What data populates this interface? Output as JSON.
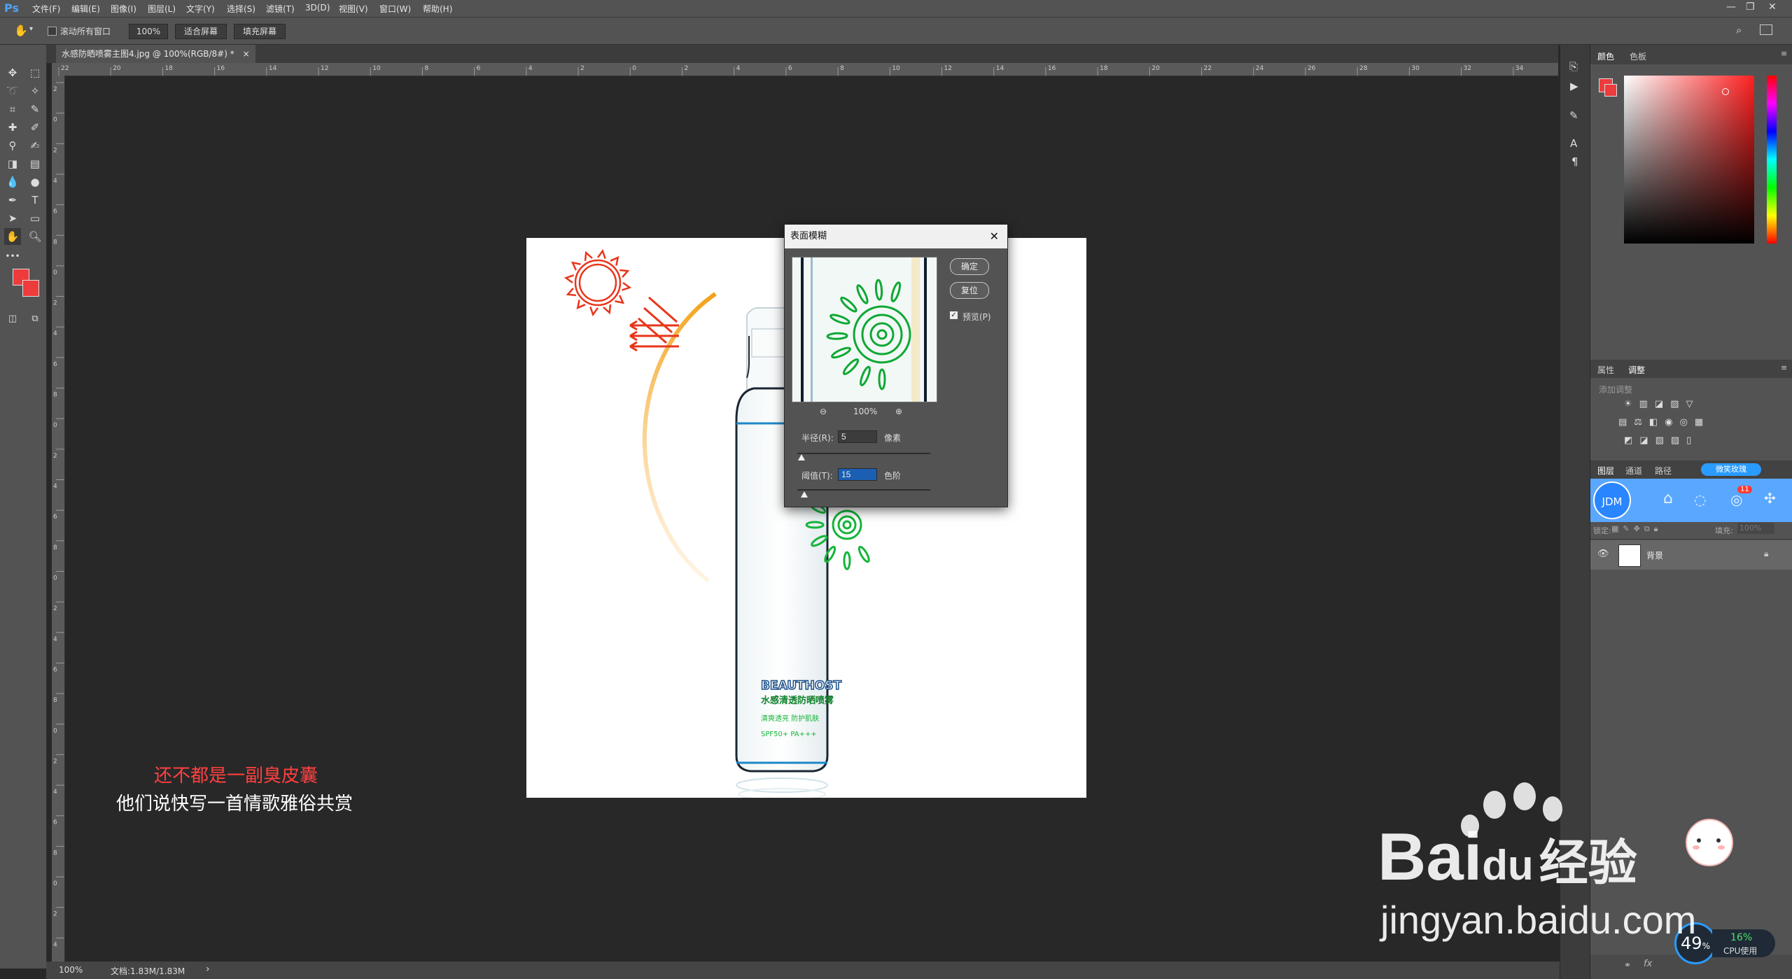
{
  "app": {
    "logo": "Ps",
    "menus": [
      "文件(F)",
      "编辑(E)",
      "图像(I)",
      "图层(L)",
      "文字(Y)",
      "选择(S)",
      "滤镜(T)",
      "3D(D)",
      "视图(V)",
      "窗口(W)",
      "帮助(H)"
    ],
    "window_controls": [
      "—",
      "❐",
      "✕"
    ]
  },
  "options": {
    "scroll_all_label": "滚动所有窗口",
    "zoom_value": "100%",
    "fit_screen": "适合屏幕",
    "fill_screen": "填充屏幕"
  },
  "document": {
    "tab_title": "水感防晒喷雾主图4.jpg @ 100%(RGB/8#) *",
    "close": "×"
  },
  "ruler": {
    "h_ticks": [
      "22",
      "20",
      "18",
      "16",
      "14",
      "12",
      "10",
      "8",
      "6",
      "4",
      "2",
      "0",
      "2",
      "4",
      "6",
      "8",
      "10",
      "12",
      "14",
      "16",
      "18",
      "20",
      "22",
      "24",
      "26",
      "28",
      "30",
      "32",
      "34"
    ],
    "v_ticks": [
      "2",
      "0",
      "2",
      "4",
      "6",
      "8",
      "0",
      "2",
      "4",
      "6",
      "8",
      "0",
      "2",
      "4",
      "6",
      "8",
      "0",
      "2",
      "4",
      "6",
      "8",
      "0",
      "2",
      "4",
      "6",
      "8",
      "0",
      "2",
      "4"
    ]
  },
  "canvas": {
    "product_brand": "BEAUTHOST",
    "product_line1": "水感清透防晒喷雾",
    "product_line2": "清爽透亮 防护肌肤",
    "product_line3": "SPF50+ PA+++"
  },
  "dialog": {
    "title": "表面模糊",
    "ok": "确定",
    "reset": "复位",
    "preview_label": "预览(P)",
    "preview_checked": true,
    "zoom_value": "100%",
    "radius_label": "半径(R):",
    "radius_value": "5",
    "radius_unit": "像素",
    "radius_slider": 0.03,
    "threshold_label": "阈值(T):",
    "threshold_value": "15",
    "threshold_unit": "色阶",
    "threshold_slider": 0.05
  },
  "subtitles": {
    "line1": "还不都是一副臭皮囊",
    "line2": "他们说快写一首情歌雅俗共赏"
  },
  "status": {
    "zoom": "100%",
    "doc_size": "文档:1.83M/1.83M",
    "arrow": "›"
  },
  "panels": {
    "color_tabs": [
      "颜色",
      "色板"
    ],
    "adjust_tabs": [
      "属性",
      "调整"
    ],
    "adjust_hint": "添加调整",
    "layer_tabs": [
      "图层",
      "通道",
      "路径"
    ],
    "lock_label": "锁定:",
    "fill_label": "填充:",
    "fill_value": "100%",
    "layer_name": "背景",
    "plugin_button": "微笑玫瑰",
    "jdm_label": "JDM",
    "jdm_badge": "11",
    "fx_label": "fx"
  },
  "cpu": {
    "percent": "49",
    "percent_suffix": "%",
    "usage": "16%",
    "usage_label": "CPU使用"
  },
  "watermark": {
    "brand": "Bai",
    "brand_du": "du",
    "product": "经验",
    "url": "jingyan.baidu.com"
  },
  "colors": {
    "foreground": "#ee3b3b",
    "background": "#ee3b3b",
    "accent": "#2a9bff"
  }
}
